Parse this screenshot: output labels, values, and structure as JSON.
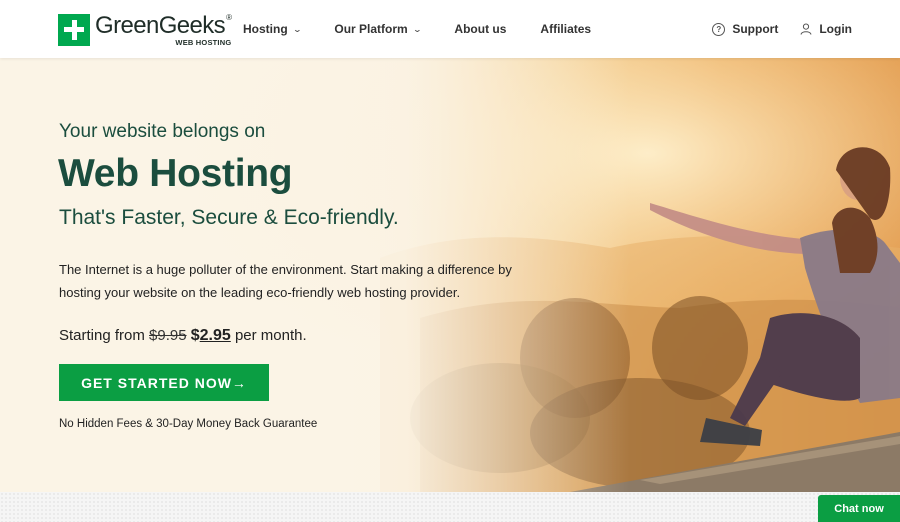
{
  "brand": {
    "name": "GreenGeeks",
    "mark": "®",
    "tagline": "WEB HOSTING",
    "color": "#00a84f"
  },
  "nav": {
    "left": [
      {
        "label": "Hosting",
        "dropdown": true
      },
      {
        "label": "Our Platform",
        "dropdown": true
      },
      {
        "label": "About us",
        "dropdown": false
      },
      {
        "label": "Affiliates",
        "dropdown": false
      }
    ],
    "support_label": "Support",
    "login_label": "Login"
  },
  "hero": {
    "eyebrow": "Your website belongs on",
    "headline": "Web Hosting",
    "subhead": "That's Faster, Secure & Eco-friendly.",
    "description": "The Internet is a huge polluter of the environment. Start making a difference by hosting your website on the leading eco-friendly web hosting provider.",
    "price": {
      "prefix": "Starting from ",
      "old": "$9.95",
      "currency": "$",
      "new": "2.95",
      "suffix": " per month."
    },
    "cta_label": "GET STARTED NOW",
    "cta_arrow": "→",
    "guarantee": "No Hidden Fees & 30-Day Money Back Guarantee",
    "accent_color": "#1b4d3e",
    "cta_color": "#0b9e43"
  },
  "chat": {
    "label": "Chat now"
  }
}
